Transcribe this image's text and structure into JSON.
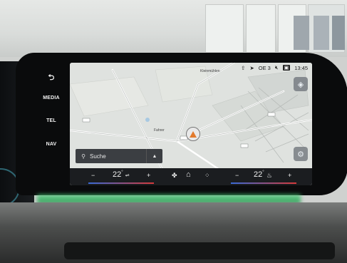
{
  "side_buttons": {
    "back_label": "⮌",
    "media_label": "MEDIA",
    "tel_label": "TEL",
    "nav_label": "NAV"
  },
  "status_bar": {
    "location": "OE 3",
    "time": "13:45"
  },
  "map": {
    "labels": [
      "Kleinmühlen",
      "Fahrer"
    ]
  },
  "search": {
    "label": "Suche",
    "expand_icon": "▲"
  },
  "climate": {
    "left_minus": "−",
    "left_temp": "22",
    "left_temp_unit": "°",
    "left_plus": "+",
    "right_minus": "−",
    "right_temp": "22",
    "right_temp_unit": "°",
    "right_plus": "+",
    "fan_icon": "fan-icon",
    "home_icon": "home-icon",
    "apps_icon": "apps-icon"
  },
  "colors": {
    "screen_bg": "#dde0dd",
    "climate_bg": "#1b1d20",
    "route_orange": "#e27a2c",
    "ambient_green": "#4ad07a"
  }
}
